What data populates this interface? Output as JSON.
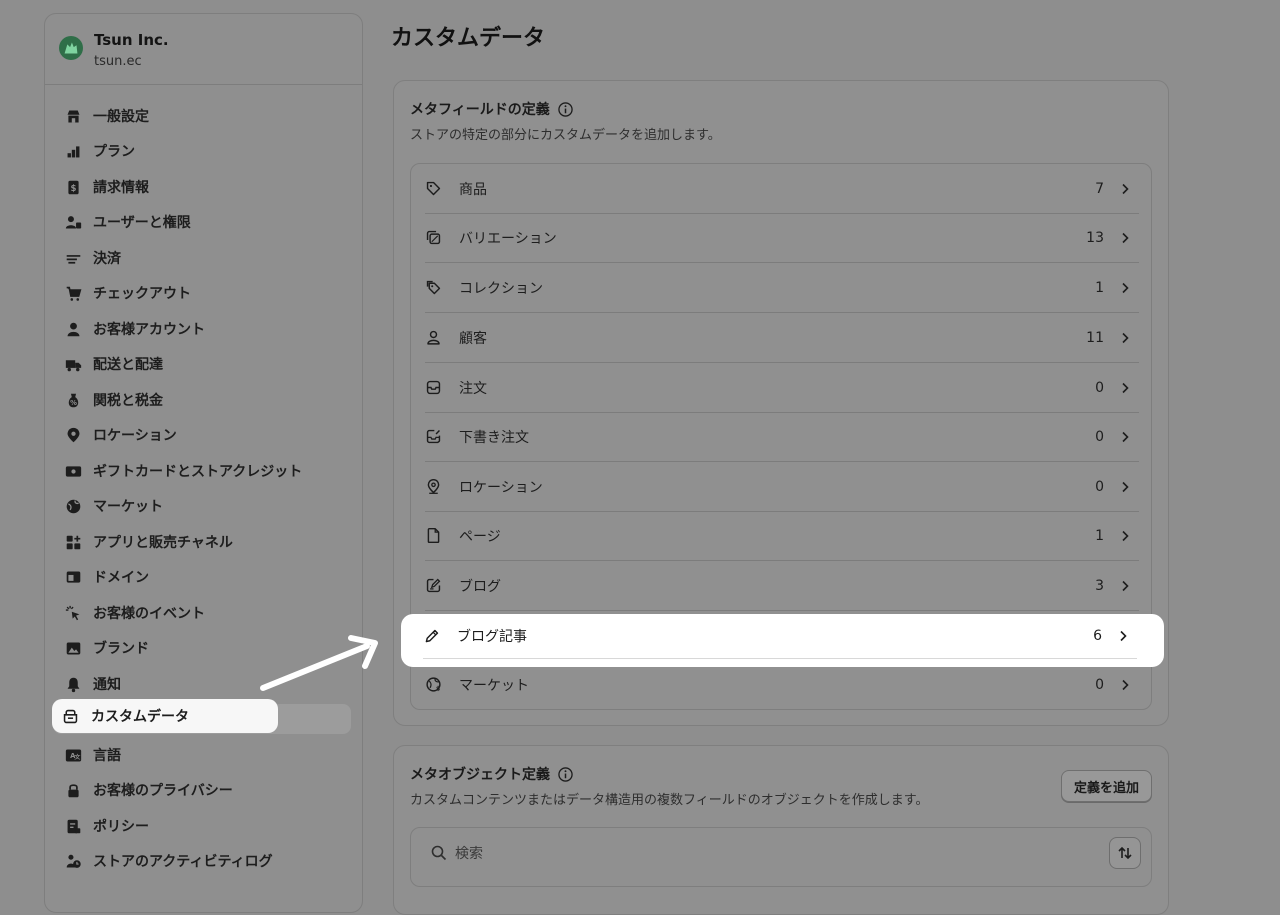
{
  "store": {
    "name": "Tsun Inc.",
    "domain": "tsun.ec"
  },
  "sidebar": {
    "items": [
      {
        "label": "一般設定",
        "icon": "store-icon"
      },
      {
        "label": "プラン",
        "icon": "plan-icon"
      },
      {
        "label": "請求情報",
        "icon": "billing-icon"
      },
      {
        "label": "ユーザーと権限",
        "icon": "users-icon"
      },
      {
        "label": "決済",
        "icon": "payments-icon"
      },
      {
        "label": "チェックアウト",
        "icon": "cart-icon"
      },
      {
        "label": "お客様アカウント",
        "icon": "person-icon"
      },
      {
        "label": "配送と配達",
        "icon": "truck-icon"
      },
      {
        "label": "関税と税金",
        "icon": "tax-icon"
      },
      {
        "label": "ロケーション",
        "icon": "location-icon"
      },
      {
        "label": "ギフトカードとストアクレジット",
        "icon": "gift-card-icon"
      },
      {
        "label": "マーケット",
        "icon": "globe-icon"
      },
      {
        "label": "アプリと販売チャネル",
        "icon": "apps-icon"
      },
      {
        "label": "ドメイン",
        "icon": "domain-icon"
      },
      {
        "label": "お客様のイベント",
        "icon": "cursor-click-icon"
      },
      {
        "label": "ブランド",
        "icon": "brand-icon"
      },
      {
        "label": "通知",
        "icon": "bell-icon"
      },
      {
        "label": "カスタムデータ",
        "icon": "custom-data-icon"
      },
      {
        "label": "言語",
        "icon": "language-icon"
      },
      {
        "label": "お客様のプライバシー",
        "icon": "lock-icon"
      },
      {
        "label": "ポリシー",
        "icon": "policy-icon"
      },
      {
        "label": "ストアのアクティビティログ",
        "icon": "activity-log-icon"
      }
    ]
  },
  "main": {
    "title": "カスタムデータ",
    "metafields": {
      "title": "メタフィールドの定義",
      "subtitle": "ストアの特定の部分にカスタムデータを追加します。",
      "rows": [
        {
          "label": "商品",
          "count": "7",
          "icon": "tag-icon"
        },
        {
          "label": "バリエーション",
          "count": "13",
          "icon": "variant-icon"
        },
        {
          "label": "コレクション",
          "count": "1",
          "icon": "collection-icon"
        },
        {
          "label": "顧客",
          "count": "11",
          "icon": "person-icon"
        },
        {
          "label": "注文",
          "count": "0",
          "icon": "order-icon"
        },
        {
          "label": "下書き注文",
          "count": "0",
          "icon": "draft-order-icon"
        },
        {
          "label": "ロケーション",
          "count": "0",
          "icon": "location-icon"
        },
        {
          "label": "ページ",
          "count": "1",
          "icon": "page-icon"
        },
        {
          "label": "ブログ",
          "count": "3",
          "icon": "blog-icon"
        },
        {
          "label": "ブログ記事",
          "count": "6",
          "icon": "pencil-icon"
        },
        {
          "label": "マーケット",
          "count": "0",
          "icon": "globe-icon"
        }
      ]
    },
    "metaobjects": {
      "title": "メタオブジェクト定義",
      "subtitle": "カスタムコンテンツまたはデータ構造用の複数フィールドのオブジェクトを作成します。",
      "add_button": "定義を追加",
      "search_placeholder": "検索"
    }
  },
  "colors": {
    "highlight": "#ffffff",
    "dim_background": "#8e8e8e",
    "store_logo": "#2f6e48"
  }
}
